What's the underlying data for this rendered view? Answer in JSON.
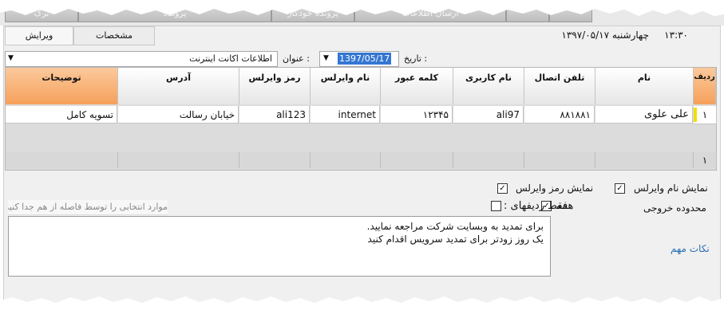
{
  "top_tabs": [
    "برگ",
    "پرونده",
    "پرونده خودکار",
    "ارسال اطلاعات",
    "",
    ""
  ],
  "sub_tabs": {
    "edit": "ویرایش",
    "details": "مشخصات"
  },
  "header": {
    "time": "۱۳:۳۰",
    "date": "چهارشنبه ۱۳۹۷/۰۵/۱۷"
  },
  "form": {
    "date_label": "تاریخ :",
    "date_value": "1397/05/17",
    "title_label": "عنوان :",
    "title_value": "اطلاعات اکانت اینترنت"
  },
  "grid": {
    "columns": [
      "ردیف",
      "نام",
      "تلفن اتصال",
      "نام کاربری",
      "کلمه عبور",
      "نام وایرلس",
      "رمز وایرلس",
      "آدرس",
      "توضیحات"
    ],
    "rows": [
      [
        "۱",
        "علی علوی",
        "۸۸۱۸۸۱",
        "ali97",
        "۱۲۳۴۵",
        "internet",
        "ali123",
        "خیابان رسالت",
        "تسویه کامل"
      ]
    ],
    "summary_row_number": "۱"
  },
  "options": {
    "show_wireless_name": "نمایش نام وایرلس",
    "show_wireless_pass": "نمایش رمز وایرلس",
    "output_range": "محدوده خروجی",
    "all_label": "همه",
    "only_rows_label": "فقط ردیفهای :",
    "rows_hint": "موارد انتخابی را توسط فاصله از هم جدا کنید"
  },
  "notes": {
    "label": "نکات مهم",
    "line1": "برای تمدید به وبسایت شرکت مراجعه نمایید.",
    "line2": "یک روز زودتر برای تمدید سرویس اقدام کنید"
  },
  "colors": {
    "accent_header": "#f6a05a",
    "row_marker": "#f2e000",
    "link": "#2a6fb3"
  }
}
